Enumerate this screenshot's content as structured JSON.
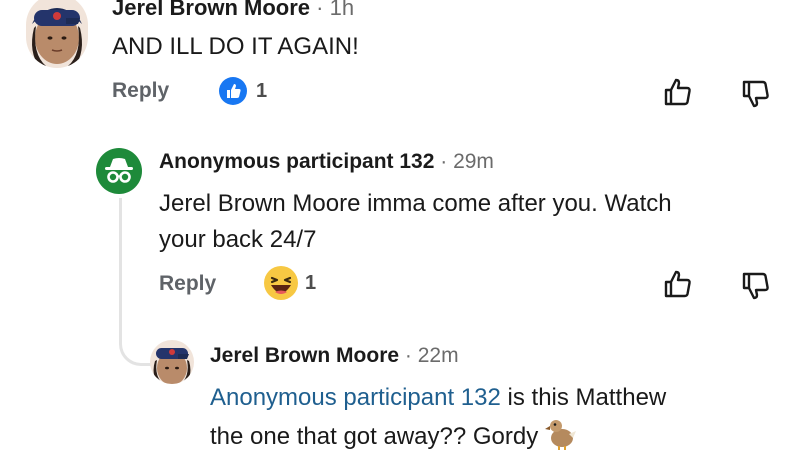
{
  "comment1": {
    "author": "Jerel Brown Moore",
    "separator": "·",
    "time": "1h",
    "text": "AND ILL DO IT AGAIN!",
    "reply_label": "Reply",
    "reaction_count": "1",
    "reaction_icon": "like-reaction-icon"
  },
  "comment2": {
    "author": "Anonymous participant 132",
    "separator": "·",
    "time": "29m",
    "text_line1": "Jerel Brown Moore imma come after you. Watch",
    "text_line2": "your back 24/7",
    "reply_label": "Reply",
    "reaction_count": "1",
    "reaction_icon": "haha-reaction-icon"
  },
  "comment3": {
    "author": "Jerel Brown Moore",
    "separator": "·",
    "time": "22m",
    "mention": "Anonymous participant 132",
    "text_rest": " is this Matthew",
    "text_line2": "the one that got away?? Gordy",
    "emoji": "dodo-bird"
  },
  "colors": {
    "like_blue": "#1877f2",
    "anon_green": "#1e8a3a",
    "mention_blue": "#1f5f8f",
    "emoji_yellow": "#f7c843"
  }
}
